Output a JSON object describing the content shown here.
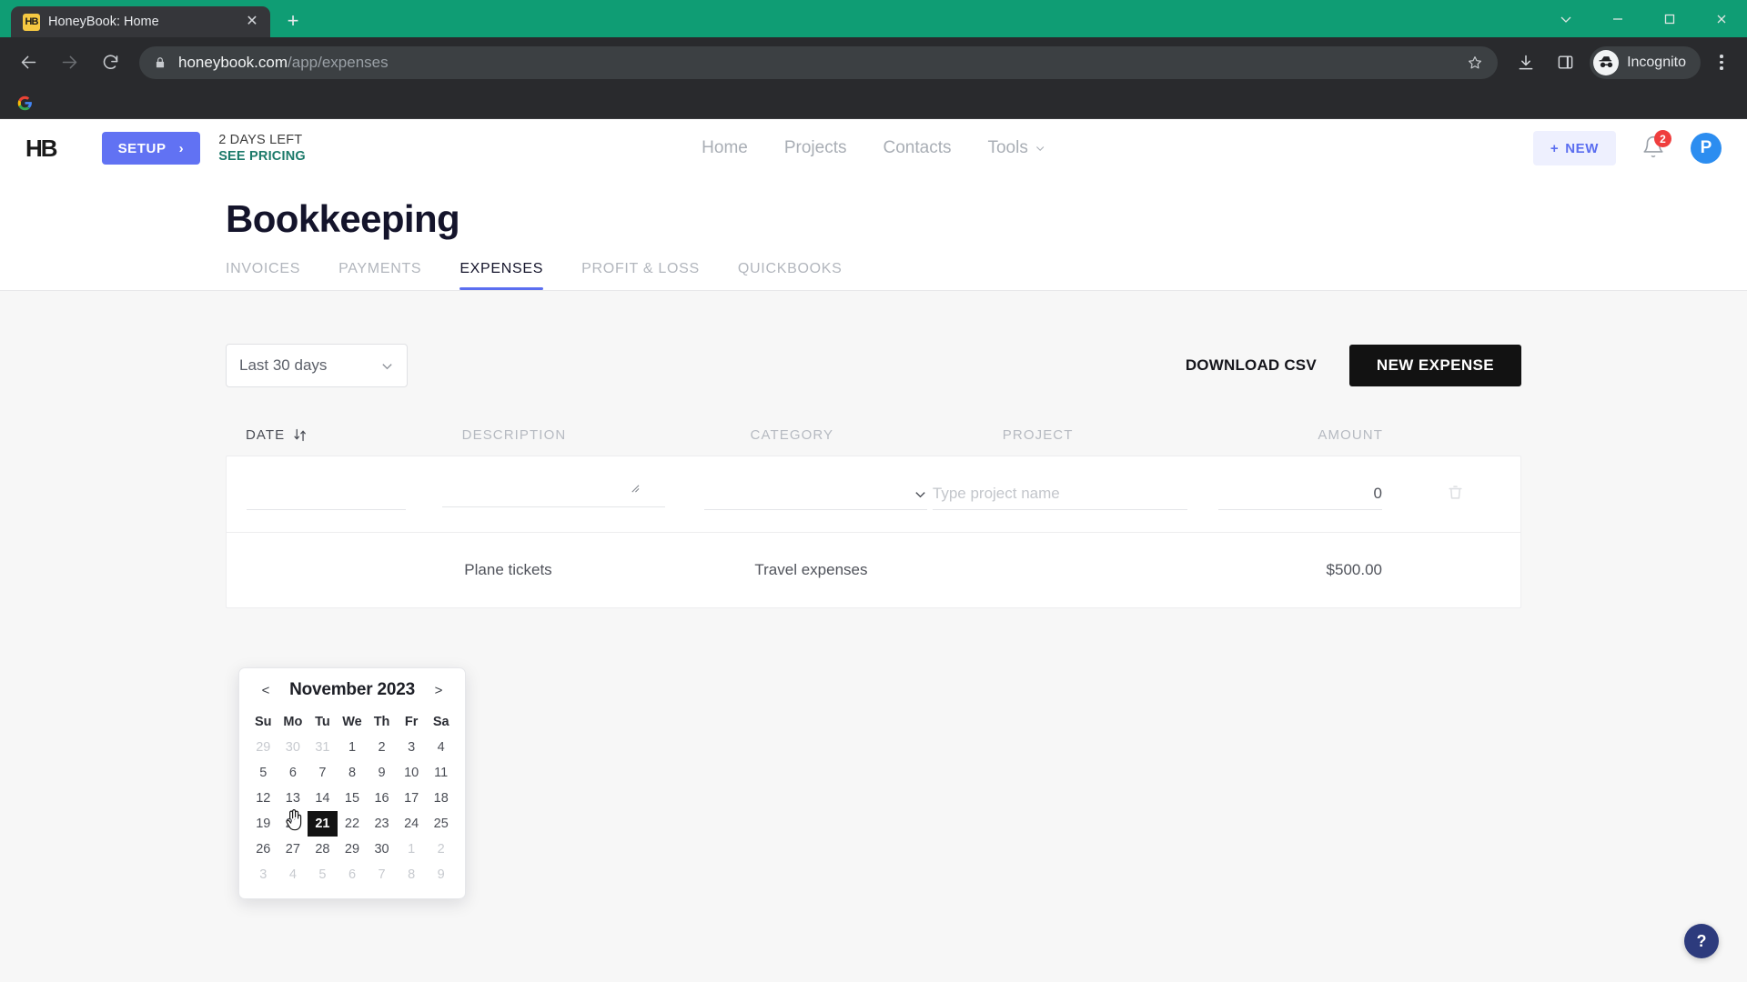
{
  "browser": {
    "tab": {
      "title": "HoneyBook: Home",
      "favicon": "HB",
      "close_icon": "close-icon"
    },
    "new_tab_label": "+",
    "window_controls": [
      "chevron-down-icon",
      "minimize-icon",
      "maximize-icon",
      "close-icon"
    ],
    "nav": {
      "back": "back-arrow-icon",
      "forward": "forward-arrow-icon",
      "reload": "reload-icon"
    },
    "address": {
      "domain": "honeybook.com",
      "path": "/app/expenses",
      "lock": "lock-icon"
    },
    "toolbar_icons": [
      "star-icon",
      "download-icon",
      "side-panel-icon"
    ],
    "profile": {
      "label": "Incognito",
      "icon": "incognito-icon"
    },
    "menu_icon": "kebab-menu-icon",
    "bookmarks": [
      {
        "name": "google-bookmark",
        "icon": "google-icon"
      }
    ],
    "theme_color": "#0f9d74"
  },
  "app": {
    "logo": "HB",
    "setup": {
      "label": "SETUP",
      "chevron": "›",
      "color": "#6172f3"
    },
    "trial": {
      "days_left": "2 DAYS LEFT",
      "pricing_link": "SEE PRICING"
    },
    "nav": [
      {
        "label": "Home",
        "caret": false
      },
      {
        "label": "Projects",
        "caret": false
      },
      {
        "label": "Contacts",
        "caret": false
      },
      {
        "label": "Tools",
        "caret": true
      }
    ],
    "new_button": {
      "label": "NEW",
      "plus": "+"
    },
    "notifications": {
      "count": "2",
      "icon": "bell-icon"
    },
    "avatar": {
      "initial": "P",
      "color": "#2c8df0"
    },
    "help": {
      "label": "?"
    }
  },
  "page": {
    "title": "Bookkeeping",
    "tabs": [
      {
        "label": "INVOICES",
        "active": false
      },
      {
        "label": "PAYMENTS",
        "active": false
      },
      {
        "label": "EXPENSES",
        "active": true
      },
      {
        "label": "PROFIT & LOSS",
        "active": false
      },
      {
        "label": "QUICKBOOKS",
        "active": false
      }
    ]
  },
  "controls": {
    "date_filter": {
      "value": "Last 30 days",
      "caret": "chevron-down-icon"
    },
    "download_csv": "DOWNLOAD CSV",
    "new_expense": "NEW EXPENSE"
  },
  "table": {
    "headers": {
      "date": "DATE",
      "description": "DESCRIPTION",
      "category": "CATEGORY",
      "project": "PROJECT",
      "amount": "AMOUNT"
    },
    "sort_icon": "sort-arrows-icon",
    "new_row": {
      "date_value": "",
      "date_placeholder": "",
      "description_value": "",
      "description_placeholder": "",
      "category_value": "",
      "project_placeholder": "Type project name",
      "project_value": "",
      "amount_value": "0",
      "delete_icon": "trash-icon"
    },
    "rows": [
      {
        "date": "",
        "description": "Plane tickets",
        "category": "Travel expenses",
        "project": "",
        "amount": "$500.00"
      }
    ]
  },
  "datepicker": {
    "prev": "<",
    "next": ">",
    "title": "November 2023",
    "dow": [
      "Su",
      "Mo",
      "Tu",
      "We",
      "Th",
      "Fr",
      "Sa"
    ],
    "selected": "21",
    "weeks": [
      [
        {
          "d": "29",
          "muted": true
        },
        {
          "d": "30",
          "muted": true
        },
        {
          "d": "31",
          "muted": true
        },
        {
          "d": "1",
          "muted": false
        },
        {
          "d": "2",
          "muted": false
        },
        {
          "d": "3",
          "muted": false
        },
        {
          "d": "4",
          "muted": false
        }
      ],
      [
        {
          "d": "5",
          "muted": false
        },
        {
          "d": "6",
          "muted": false
        },
        {
          "d": "7",
          "muted": false
        },
        {
          "d": "8",
          "muted": false
        },
        {
          "d": "9",
          "muted": false
        },
        {
          "d": "10",
          "muted": false
        },
        {
          "d": "11",
          "muted": false
        }
      ],
      [
        {
          "d": "12",
          "muted": false
        },
        {
          "d": "13",
          "muted": false
        },
        {
          "d": "14",
          "muted": false
        },
        {
          "d": "15",
          "muted": false
        },
        {
          "d": "16",
          "muted": false
        },
        {
          "d": "17",
          "muted": false
        },
        {
          "d": "18",
          "muted": false
        }
      ],
      [
        {
          "d": "19",
          "muted": false
        },
        {
          "d": "20",
          "muted": false
        },
        {
          "d": "21",
          "muted": false
        },
        {
          "d": "22",
          "muted": false
        },
        {
          "d": "23",
          "muted": false
        },
        {
          "d": "24",
          "muted": false
        },
        {
          "d": "25",
          "muted": false
        }
      ],
      [
        {
          "d": "26",
          "muted": false
        },
        {
          "d": "27",
          "muted": false
        },
        {
          "d": "28",
          "muted": false
        },
        {
          "d": "29",
          "muted": false
        },
        {
          "d": "30",
          "muted": false
        },
        {
          "d": "1",
          "muted": true
        },
        {
          "d": "2",
          "muted": true
        }
      ],
      [
        {
          "d": "3",
          "muted": true
        },
        {
          "d": "4",
          "muted": true
        },
        {
          "d": "5",
          "muted": true
        },
        {
          "d": "6",
          "muted": true
        },
        {
          "d": "7",
          "muted": true
        },
        {
          "d": "8",
          "muted": true
        },
        {
          "d": "9",
          "muted": true
        }
      ]
    ]
  }
}
